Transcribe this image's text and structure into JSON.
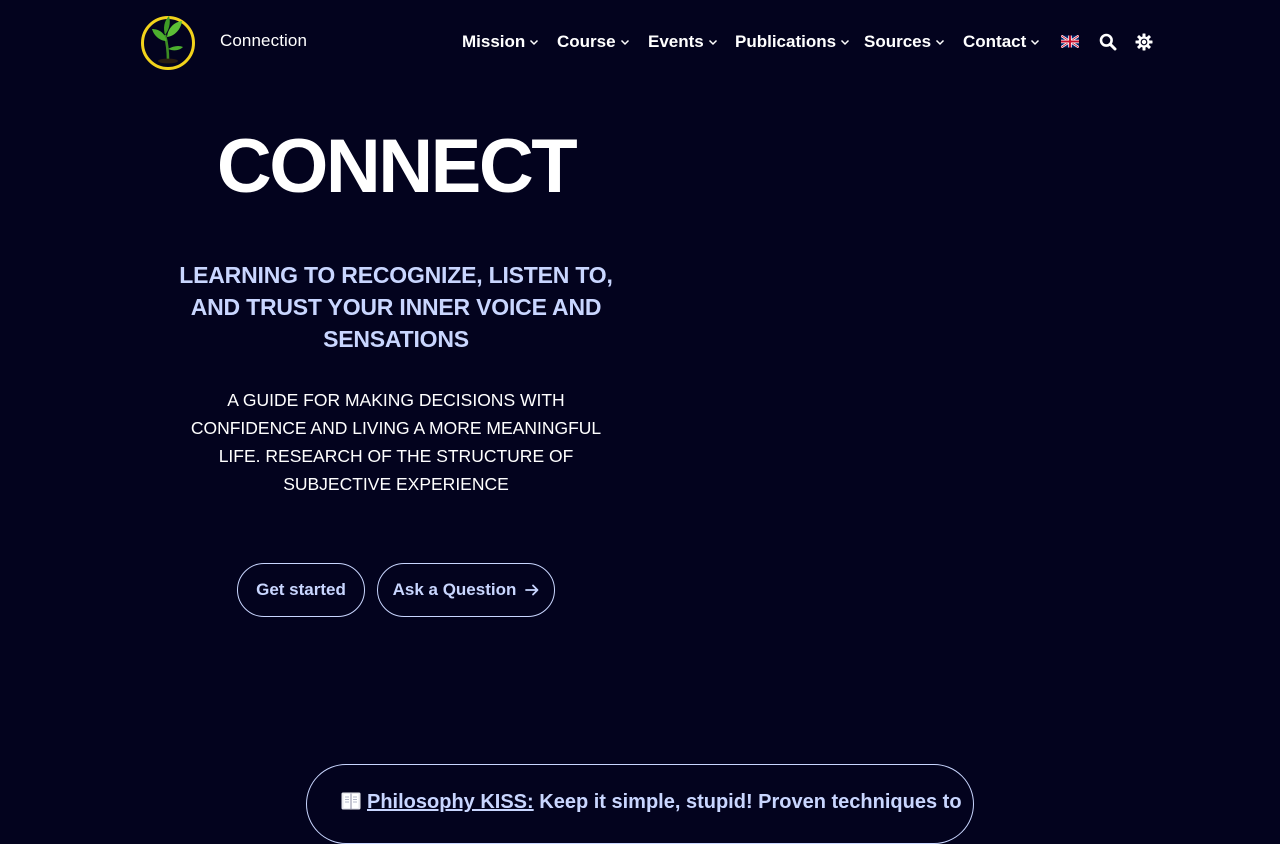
{
  "header": {
    "brand": "Connection",
    "nav": [
      {
        "label": "Mission"
      },
      {
        "label": "Course"
      },
      {
        "label": "Events"
      },
      {
        "label": "Publications"
      },
      {
        "label": "Sources"
      },
      {
        "label": "Contact"
      }
    ],
    "icons": {
      "logo": "plant-sprout-logo",
      "language": "uk-flag-icon",
      "search": "search-icon",
      "theme": "sun-gear-icon",
      "dropdown": "chevron-down-icon"
    }
  },
  "hero": {
    "title": "CONNECT",
    "subtitle": "LEARNING TO RECOGNIZE, LISTEN TO, AND TRUST YOUR INNER VOICE AND SENSATIONS",
    "text": "A GUIDE FOR MAKING DECISIONS WITH CONFIDENCE AND LIVING A MORE MEANINGFUL LIFE. RESEARCH OF THE STRUCTURE OF SUBJECTIVE EXPERIENCE",
    "primary_button": "Get started",
    "secondary_button": "Ask a Question"
  },
  "banner": {
    "emphasis": "Philosophy KISS:",
    "text": "Keep it simple, stupid! Proven techniques to"
  },
  "colors": {
    "background": "#03031e",
    "accent": "#c9d6ff",
    "text": "#ffffff",
    "logo_ring": "#f2d31b",
    "leaf": "#4caf2e"
  }
}
